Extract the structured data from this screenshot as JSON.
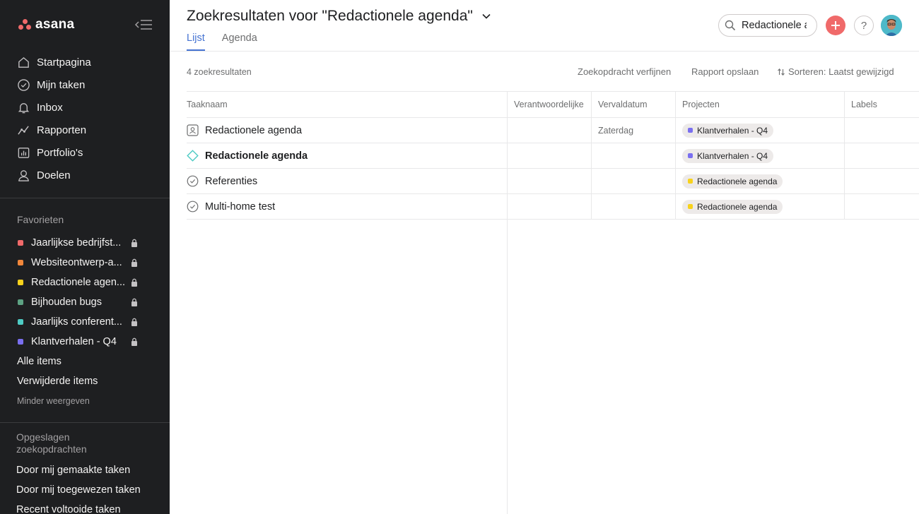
{
  "brand": {
    "name": "asana",
    "color": "#f06a6a"
  },
  "sidebar": {
    "nav": [
      {
        "label": "Startpagina",
        "icon": "home-icon"
      },
      {
        "label": "Mijn taken",
        "icon": "check-circle-icon"
      },
      {
        "label": "Inbox",
        "icon": "bell-icon"
      },
      {
        "label": "Rapporten",
        "icon": "chart-line-icon"
      },
      {
        "label": "Portfolio's",
        "icon": "bar-chart-icon"
      },
      {
        "label": "Doelen",
        "icon": "person-icon"
      }
    ],
    "favorites_title": "Favorieten",
    "favorites": [
      {
        "label": "Jaarlijkse bedrijfst...",
        "color": "#f06a6a"
      },
      {
        "label": "Websiteontwerp-a...",
        "color": "#f1873b"
      },
      {
        "label": "Redactionele agen...",
        "color": "#f8d21c"
      },
      {
        "label": "Bijhouden bugs",
        "color": "#5da283"
      },
      {
        "label": "Jaarlijks conferent...",
        "color": "#4ecbc4"
      },
      {
        "label": "Klantverhalen - Q4",
        "color": "#7a6ff0"
      }
    ],
    "all_items": "Alle items",
    "deleted_items": "Verwijderde items",
    "show_less": "Minder weergeven",
    "saved_title": "Opgeslagen zoekopdrachten",
    "saved": [
      {
        "label": "Door mij gemaakte taken"
      },
      {
        "label": "Door mij toegewezen taken"
      },
      {
        "label": "Recent voltooide taken"
      }
    ]
  },
  "header": {
    "title": "Zoekresultaten voor \"Redactionele agenda\"",
    "tabs": [
      {
        "label": "Lijst",
        "active": true
      },
      {
        "label": "Agenda",
        "active": false
      }
    ],
    "search_value": "Redactionele agenda",
    "help_label": "?"
  },
  "toolbar": {
    "count": "4 zoekresultaten",
    "refine": "Zoekopdracht verfijnen",
    "save_report": "Rapport opslaan",
    "sort": "Sorteren: Laatst gewijzigd"
  },
  "table": {
    "columns": {
      "name": "Taaknaam",
      "assignee": "Verantwoordelijke",
      "due": "Vervaldatum",
      "projects": "Projecten",
      "labels": "Labels"
    },
    "rows": [
      {
        "name": "Redactionele agenda",
        "icon": "approval-icon",
        "bold": false,
        "due": "Zaterdag",
        "project": "Klantverhalen - Q4",
        "project_color": "#7a6ff0"
      },
      {
        "name": "Redactionele agenda",
        "icon": "milestone-icon",
        "bold": true,
        "due": "",
        "project": "Klantverhalen - Q4",
        "project_color": "#7a6ff0"
      },
      {
        "name": "Referenties",
        "icon": "check-circle-icon",
        "bold": false,
        "due": "",
        "project": "Redactionele agenda",
        "project_color": "#f8d21c"
      },
      {
        "name": "Multi-home test",
        "icon": "check-circle-icon",
        "bold": false,
        "due": "",
        "project": "Redactionele agenda",
        "project_color": "#f8d21c"
      }
    ]
  }
}
